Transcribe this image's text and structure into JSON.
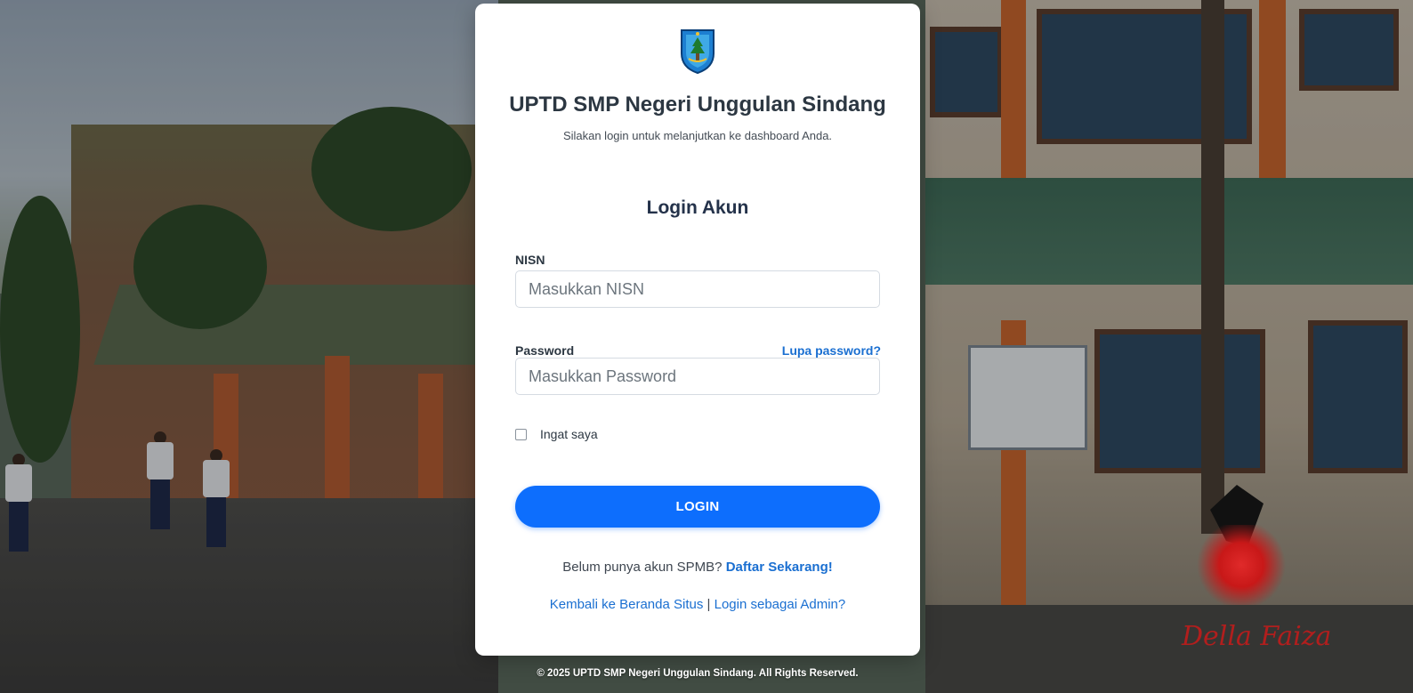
{
  "brand": {
    "title": "UPTD SMP Negeri Unggulan Sindang",
    "subtitle": "Silakan login untuk melanjutkan ke dashboard Anda.",
    "logo_icon": "school-crest-icon"
  },
  "form": {
    "title": "Login Akun",
    "nisn_label": "NISN",
    "nisn_placeholder": "Masukkan NISN",
    "nisn_value": "",
    "password_label": "Password",
    "password_placeholder": "Masukkan Password",
    "password_value": "",
    "forgot_link": "Lupa password?",
    "remember_label": "Ingat saya",
    "remember_checked": false,
    "login_button": "LOGIN"
  },
  "register": {
    "prompt": "Belum punya akun SPMB?",
    "link": "Daftar Sekarang!"
  },
  "links": {
    "home": "Kembali ke Beranda Situs",
    "separator": "|",
    "admin": "Login sebagai Admin?"
  },
  "footer": {
    "copyright": "© 2025 UPTD SMP Negeri Unggulan Sindang. All Rights Reserved."
  },
  "watermark": {
    "text": "Della Faiza"
  },
  "colors": {
    "primary": "#0d6efd",
    "link": "#1a6fd1",
    "heading": "#2c3742"
  }
}
